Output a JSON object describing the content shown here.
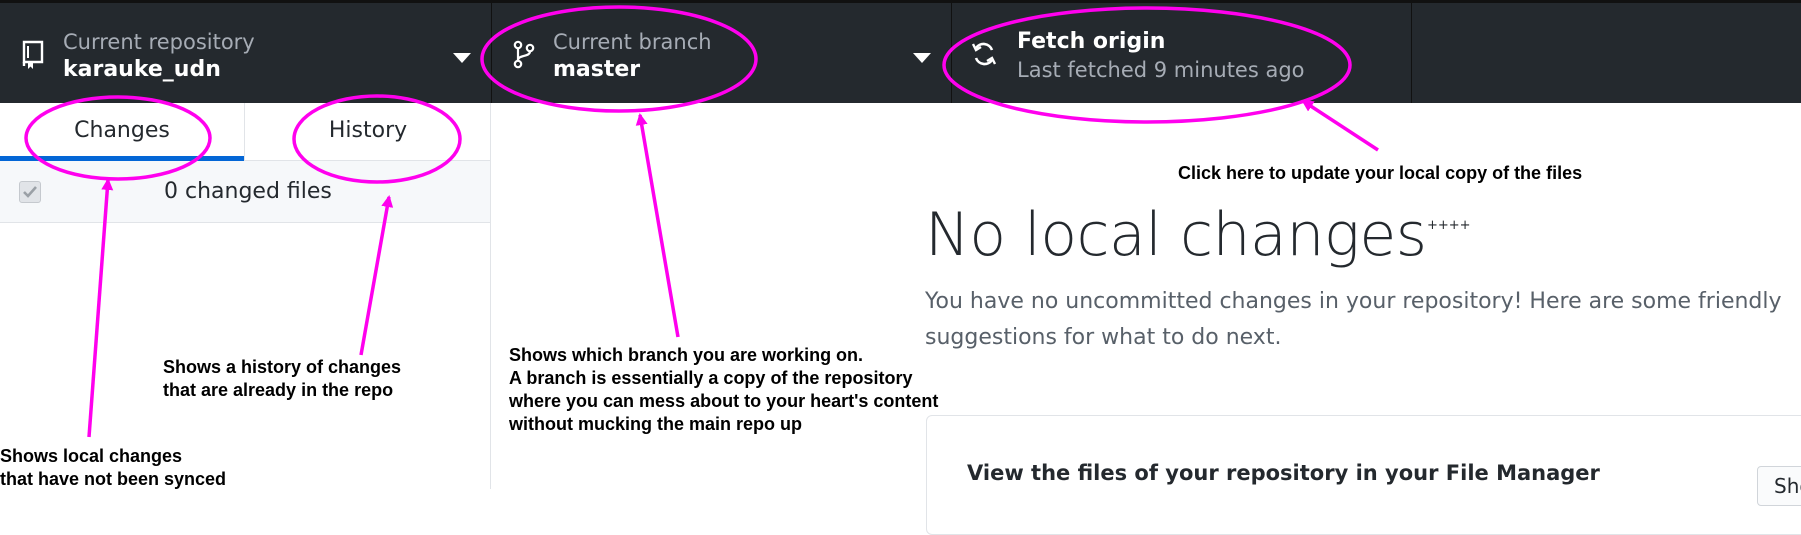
{
  "toolbar": {
    "repository": {
      "caption": "Current repository",
      "name": "karauke_udn",
      "icon": "repo-icon"
    },
    "branch": {
      "caption": "Current branch",
      "name": "master",
      "icon": "git-branch-icon"
    },
    "fetch": {
      "title": "Fetch origin",
      "status": "Last fetched 9 minutes ago",
      "icon": "sync-icon"
    }
  },
  "sidebar": {
    "tabs": [
      {
        "label": "Changes",
        "active": true
      },
      {
        "label": "History",
        "active": false
      }
    ],
    "changed_files_label": "0 changed files"
  },
  "main": {
    "title": "No local changes",
    "mark": "++++",
    "description": "You have no uncommitted changes in your repository! Here are some friendly suggestions for what to do next.",
    "card": {
      "title": "View the files of your repository in your File Manager",
      "button_label": "Show in your File Manager"
    }
  },
  "annotations": {
    "fetch": "Click here to update your local copy of the files",
    "branch": "Shows which branch you are working on.\nA branch is essentially a copy of the repository\nwhere you can mess about to your heart's content\nwithout mucking the main repo up",
    "history": "Shows a history of changes\nthat are already in the repo",
    "changes": "Shows local changes\nthat have not been synced"
  },
  "colors": {
    "toolbar_bg": "#24292e",
    "accent_blue": "#0366d6",
    "annotation": "#ff00ee"
  }
}
